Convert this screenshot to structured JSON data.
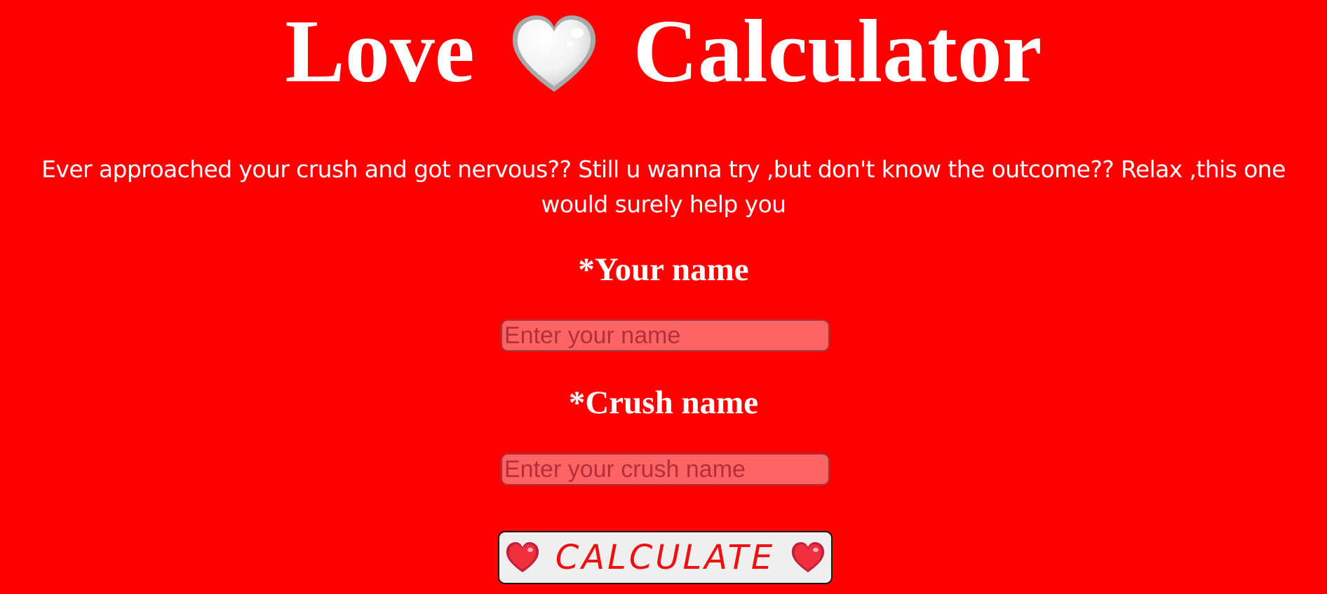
{
  "header": {
    "title_left": "Love",
    "title_right": "Calculator",
    "title_icon": "white-heart"
  },
  "intro": {
    "text": "Ever approached your crush and got nervous?? Still u wanna try ,but don't know the outcome?? Relax ,this one would surely help you"
  },
  "form": {
    "your_name_label": "*Your name",
    "your_name_placeholder": "Enter your name",
    "your_name_value": "",
    "crush_name_label": "*Crush name",
    "crush_name_placeholder": "Enter your crush name",
    "crush_name_value": "",
    "calculate_label": "CALCULATE",
    "calculate_icon": "red-heart"
  },
  "colors": {
    "background": "#ff0000",
    "text": "#ffffff",
    "input_fill": "#ff6464",
    "button_fill": "#efefef",
    "button_text": "#ee1111"
  }
}
